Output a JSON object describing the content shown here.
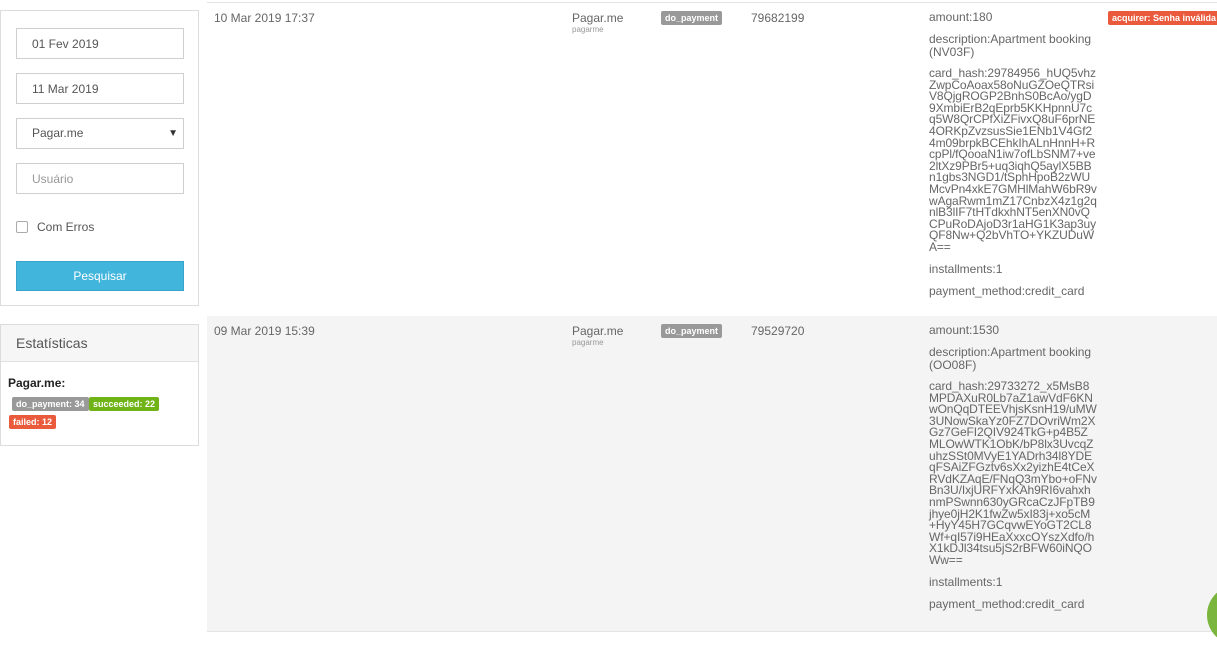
{
  "filters": {
    "date_from": "01 Fev 2019",
    "date_to": "11 Mar 2019",
    "provider_selected": "Pagar.me",
    "user_placeholder": "Usuário",
    "errors_label": "Com Erros",
    "search_label": "Pesquisar"
  },
  "stats": {
    "title": "Estatísticas",
    "provider": "Pagar.me:",
    "badges": [
      {
        "label": "do_payment: 34",
        "color": "#999999"
      },
      {
        "label": "succeeded: 22",
        "color": "#6fb317"
      },
      {
        "label": "failed: 12",
        "color": "#ea5a3c"
      }
    ]
  },
  "rows": [
    {
      "date": "10 Mar 2019 17:37",
      "provider": "Pagar.me",
      "provider_sub": "pagarme",
      "action": "do_payment",
      "id": "79682199",
      "amount": "amount:180",
      "description": "description:Apartment booking (NV03F)",
      "card_hash": "card_hash:29784956_hUQ5vhzZwpCoAoax58oNuGZOeQTRsiV8QjgROGP2BnhS0BcAo/ygD9XmbiErB2qEprb5KKHpnnU7cq5W8QrCPfXiZFivxQ8uF6prNE4ORKpZvzsusSie1ENb1V4Gf24m09brpkBCEhkIhALnHnnH+RcpPl/fQooaN1iw7ofLbSNM7+ve2ltXz9PBr5+uq3iqhQ5aylX5BBn1gbs3NGD1/tSphHpoB2zWUMcvPn4xkE7GMHlMahW6bR9vwAgaRwm1mZ17CnbzX4z1g2qnlB3lIF7tHTdkxhNT5enXN0vQCPuRoDAjoD3r1aHG1K3ap3uyQF8Nw+Q2bVhTO+YKZUDuWA==",
      "installments": "installments:1",
      "payment_method": "payment_method:credit_card",
      "status": "acquirer: Senha inválida"
    },
    {
      "date": "09 Mar 2019 15:39",
      "provider": "Pagar.me",
      "provider_sub": "pagarme",
      "action": "do_payment",
      "id": "79529720",
      "amount": "amount:1530",
      "description": "description:Apartment booking (OO08F)",
      "card_hash": "card_hash:29733272_x5MsB8MPDAXuR0Lb7aZ1awVdF6KNwOnQqDTEEVhjsKsnH19/uMW3UNowSkaYz0FZ7DOvriWm2XGz7GeFI2QIV924TkG+p4B5ZMLOwWTK1ObK/bP8lx3UvcqZuhzSSt0MVyE1YADrh34l8YDEqFSAiZFGztv6sXx2yizhE4tCeXRVdKZAqE/FNqQ3mYbo+oFNvBn3U/IxjURFYxKAh9RI6vahxhnmPSwnn630yGRcaCzJFpTB9jhye0jH2K1fwZw5xI83j+xo5cM+HyY45H7GCqvwEYoGT2CL8Wf+qI57i9HEaXxxcOYszXdfo/hX1kDJl34tsu5jS2rBFW60iNQOWw==",
      "installments": "installments:1",
      "payment_method": "payment_method:credit_card",
      "status": ""
    }
  ]
}
